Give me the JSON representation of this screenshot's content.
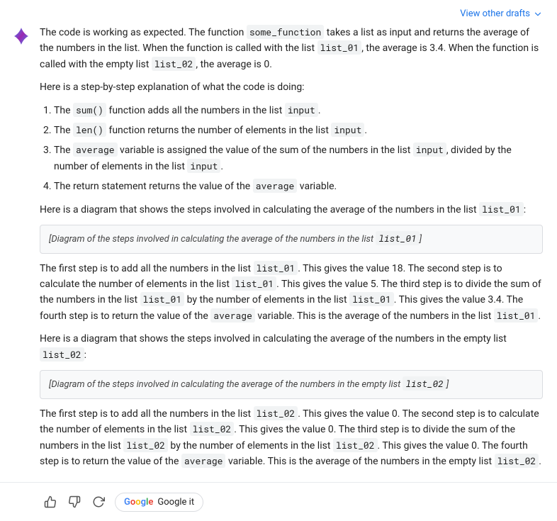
{
  "topBar": {
    "viewDraftsLabel": "View other drafts"
  },
  "response": {
    "intro": "The code is working as expected. The function ",
    "some_function": "some_function",
    "intro2": " takes a list as input and returns the average of the numbers in the list. When the function is called with the list ",
    "list_01": "list_01",
    "intro3": ", the average is 3.4. When the function is called with the empty list ",
    "list_02": "list_02",
    "intro4": ", the average is 0.",
    "stepByStepHeading": "Here is a step-by-step explanation of what the code is doing:",
    "steps": [
      {
        "text": "The ",
        "code1": "sum()",
        "text2": " function adds all the numbers in the list ",
        "code2": "input",
        "text3": "."
      },
      {
        "text": "The ",
        "code1": "len()",
        "text2": " function returns the number of elements in the list ",
        "code2": "input",
        "text3": "."
      },
      {
        "text": "The ",
        "code1": "average",
        "text2": " variable is assigned the value of the sum of the numbers in the list ",
        "code2": "input",
        "text3": ", divided by the number of elements in the list ",
        "code3": "input",
        "text4": "."
      },
      {
        "text": "The return statement returns the value of the ",
        "code1": "average",
        "text2": " variable."
      }
    ],
    "diagramHeading1": "Here is a diagram that shows the steps involved in calculating the average of the numbers in the list ",
    "diagramCode1": "list_01",
    "diagramHeading1end": ":",
    "diagramBox1": "Diagram of the steps involved in calculating the average of the numbers in the list ",
    "diagramBox1code": "list_01",
    "paragraph1": "The first step is to add all the numbers in the list ",
    "paragraph1code1": "list_01",
    "paragraph1b": ". This gives the value 18. The second step is to calculate the number of elements in the list ",
    "paragraph1code2": "list_01",
    "paragraph1c": ". This gives the value 5. The third step is to divide the sum of the numbers in the list ",
    "paragraph1code3": "list_01",
    "paragraph1d": " by the number of elements in the list ",
    "paragraph1code4": "list_01",
    "paragraph1e": ". This gives the value 3.4. The fourth step is to return the value of the ",
    "paragraph1code5": "average",
    "paragraph1f": " variable. This is the average of the numbers in the list ",
    "paragraph1code6": "list_01",
    "paragraph1g": ".",
    "diagramHeading2": "Here is a diagram that shows the steps involved in calculating the average of the numbers in the empty list ",
    "diagramCode2": "list_02",
    "diagramHeading2end": ":",
    "diagramBox2": "Diagram of the steps involved in calculating the average of the numbers in the empty list ",
    "diagramBox2code": "list_02",
    "paragraph2": "The first step is to add all the numbers in the list ",
    "paragraph2code1": "list_02",
    "paragraph2b": ". This gives the value 0. The second step is to calculate the number of elements in the list ",
    "paragraph2code2": "list_02",
    "paragraph2c": ". This gives the value 0. The third step is to divide the sum of the numbers in the list ",
    "paragraph2code3": "list_02",
    "paragraph2d": " by the number of elements in the list ",
    "paragraph2code4": "list_02",
    "paragraph2e": ". This gives the value 0. The fourth step is to return the value of the ",
    "paragraph2code5": "average",
    "paragraph2f": " variable. This is the average of the numbers in the empty list ",
    "paragraph2code6": "list_02",
    "paragraph2g": "."
  },
  "actions": {
    "thumbsUpLabel": "Thumbs up",
    "thumbsDownLabel": "Thumbs down",
    "refreshLabel": "Refresh",
    "googleItLabel": "Google it"
  }
}
